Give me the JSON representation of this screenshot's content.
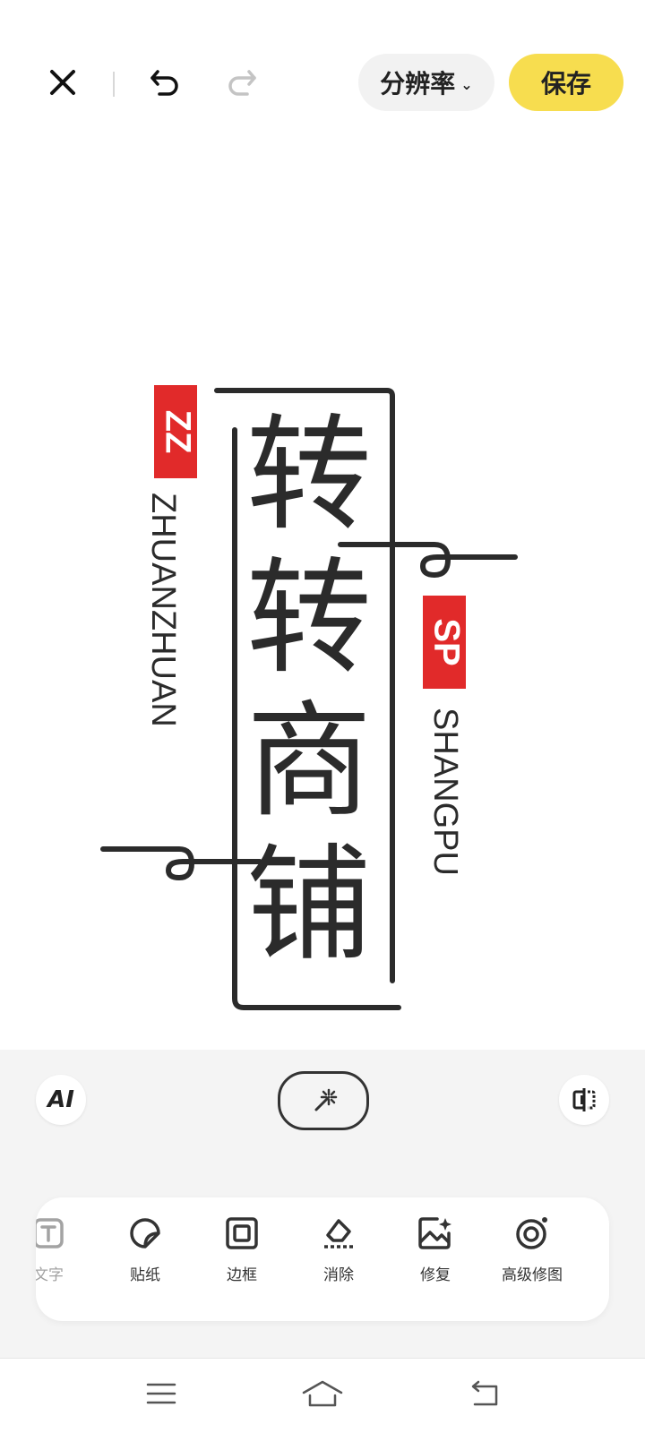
{
  "topbar": {
    "resolution_label": "分辨率",
    "save_label": "保存"
  },
  "logo": {
    "left_badge": "ZZ",
    "left_text": "ZHUANZHUAN",
    "right_badge": "SP",
    "right_text": "SHANGPU",
    "chars": [
      "转",
      "转",
      "商",
      "铺"
    ]
  },
  "tools": [
    {
      "label": "文字",
      "icon": "text-icon"
    },
    {
      "label": "贴纸",
      "icon": "sticker-icon"
    },
    {
      "label": "边框",
      "icon": "frame-icon"
    },
    {
      "label": "消除",
      "icon": "eraser-icon"
    },
    {
      "label": "修复",
      "icon": "repair-icon"
    },
    {
      "label": "高级修图",
      "icon": "advanced-retouch-icon"
    }
  ],
  "ai_label": "AI",
  "colors": {
    "save_bg": "#f7dd4f",
    "logo_red": "#e12a2a",
    "logo_ink": "#2b2b2b"
  }
}
